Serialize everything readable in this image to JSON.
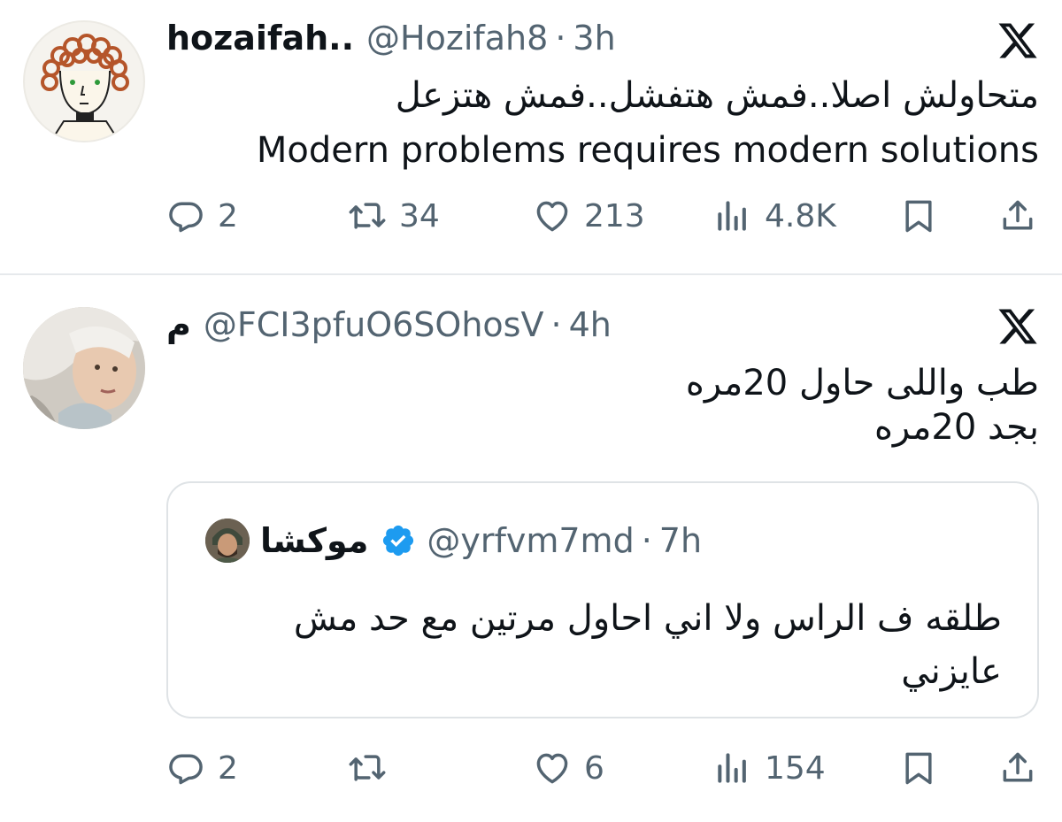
{
  "tweets": [
    {
      "name": "hozaifah..",
      "handle": "@Hozifah8",
      "time": "3h",
      "text_ar": "متحاولش اصلا..فمش هتفشل..فمش هتزعل",
      "text_en": "Modern problems requires modern solutions",
      "actions": {
        "replies": "2",
        "reposts": "34",
        "likes": "213",
        "views": "4.8K"
      }
    },
    {
      "name": "م",
      "handle": "@FCI3pfuO6SOhosV",
      "time": "4h",
      "text_line1": "طب واللى حاول 20مره",
      "text_line2": "بجد 20مره",
      "quote": {
        "name": "موكشا",
        "handle": "@yrfvm7md",
        "time": "7h",
        "text_line1": "طلقه ف الراس ولا اني احاول مرتين مع حد مش",
        "text_line2": "عايزني"
      },
      "actions": {
        "replies": "2",
        "reposts": "",
        "likes": "6",
        "views": "154"
      }
    }
  ],
  "ui": {
    "separator": "·"
  },
  "icons": [
    "x-logo-icon",
    "reply-icon",
    "repost-icon",
    "like-icon",
    "views-icon",
    "bookmark-icon",
    "share-icon",
    "verified-badge-icon"
  ],
  "colors": {
    "text": "#0f1419",
    "muted": "#536471",
    "verified": "#1d9bf0",
    "border": "#dfe3e6"
  }
}
